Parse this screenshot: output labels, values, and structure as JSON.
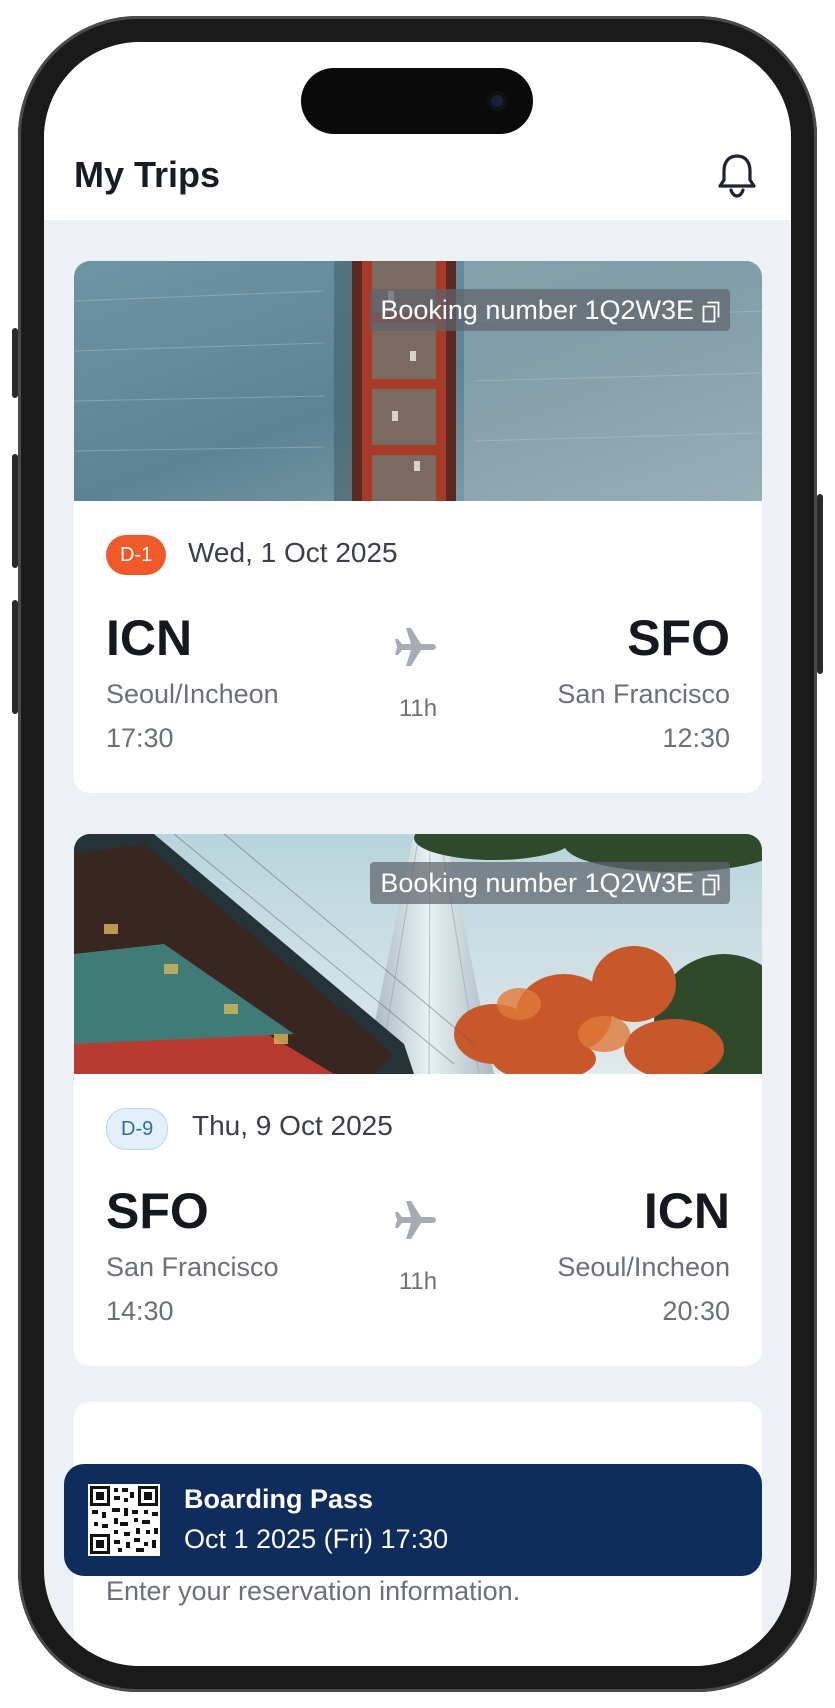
{
  "app": {
    "title": "My Trips"
  },
  "trips": [
    {
      "booking_label": "Booking number 1Q2W3E",
      "dday": "D-1",
      "date": "Wed, 1 Oct 2025",
      "from": {
        "code": "ICN",
        "city": "Seoul/Incheon",
        "time": "17:30"
      },
      "to": {
        "code": "SFO",
        "city": "San Francisco",
        "time": "12:30"
      },
      "duration": "11h",
      "badge_color": "#f05a2a"
    },
    {
      "booking_label": "Booking number 1Q2W3E",
      "dday": "D-9",
      "date": "Thu, 9 Oct 2025",
      "from": {
        "code": "SFO",
        "city": "San Francisco",
        "time": "14:30"
      },
      "to": {
        "code": "ICN",
        "city": "Seoul/Incheon",
        "time": "20:30"
      },
      "duration": "11h",
      "badge_color": "#e3f0fa"
    }
  ],
  "boarding_pass": {
    "title": "Boarding Pass",
    "subtitle": "Oct 1 2025 (Fri) 17:30",
    "color": "#0e2c5c"
  },
  "reservation_hint": "Enter your reservation information."
}
